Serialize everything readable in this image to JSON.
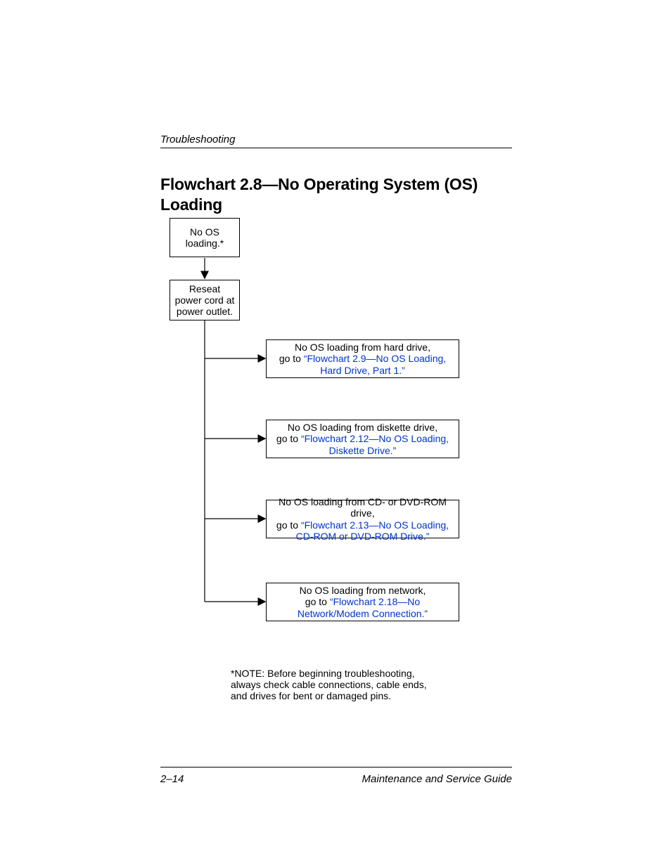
{
  "header": {
    "section": "Troubleshooting"
  },
  "title": "Flowchart 2.8—No Operating System (OS) Loading",
  "chart_data": {
    "type": "flowchart",
    "nodes": [
      {
        "id": "start",
        "text_lines": [
          "No OS",
          "loading.*"
        ]
      },
      {
        "id": "reseat",
        "text_lines": [
          "Reseat",
          "power cord at",
          "power outlet."
        ]
      },
      {
        "id": "hd",
        "pre": "No OS loading from hard drive,",
        "mid": "go to ",
        "link": "“Flowchart 2.9—No OS Loading, Hard Drive, Part 1.”"
      },
      {
        "id": "disk",
        "pre": "No OS loading from diskette drive,",
        "mid": "go to ",
        "link": "“Flowchart 2.12—No OS Loading, Diskette Drive.”"
      },
      {
        "id": "cd",
        "pre": "No OS loading from CD- or DVD-ROM drive,",
        "mid": "go to ",
        "link": "“Flowchart 2.13—No OS Loading, CD-ROM or DVD-ROM Drive.”"
      },
      {
        "id": "net",
        "pre": "No OS loading from network,",
        "mid": "go to ",
        "link": "“Flowchart 2.18—No Network/Modem Connection.”"
      }
    ],
    "edges": [
      {
        "from": "start",
        "to": "reseat"
      },
      {
        "from": "reseat",
        "to": "hd"
      },
      {
        "from": "reseat",
        "to": "disk"
      },
      {
        "from": "reseat",
        "to": "cd"
      },
      {
        "from": "reseat",
        "to": "net"
      }
    ]
  },
  "note": "*NOTE: Before beginning troubleshooting, always check cable connections, cable ends, and drives for bent or damaged pins.",
  "footer": {
    "page": "2–14",
    "doc": "Maintenance and Service Guide"
  }
}
